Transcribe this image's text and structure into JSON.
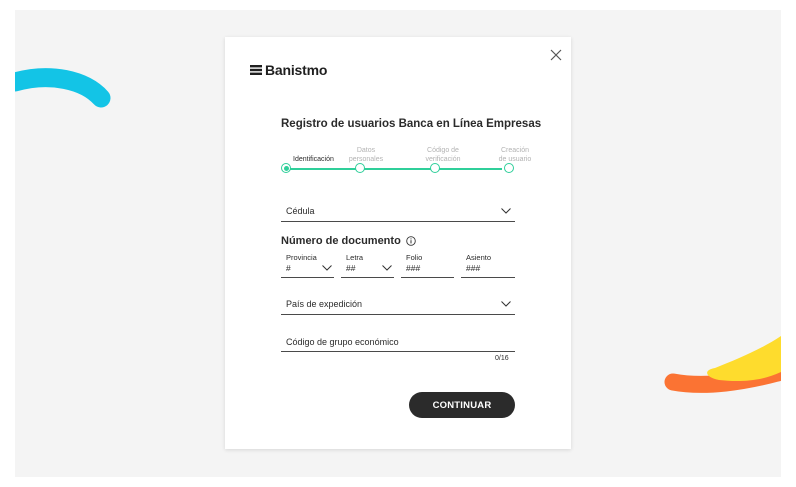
{
  "brand": {
    "name": "Banistmo",
    "logo_icon": "banistmo-logo-icon"
  },
  "colors": {
    "accent_green": "#2fcf9a",
    "button_dark": "#2b2b2b",
    "deco_cyan": "#13c4e6",
    "deco_yellow": "#fedc2d",
    "deco_orange": "#fb7333"
  },
  "modal": {
    "close_icon": "close-icon",
    "title": "Registro de usuarios Banca en Línea Empresas"
  },
  "stepper": {
    "steps": [
      {
        "label": "Identificación",
        "active": true
      },
      {
        "label_line1": "Datos",
        "label_line2": "personales",
        "active": false
      },
      {
        "label_line1": "Código de",
        "label_line2": "verificación",
        "active": false
      },
      {
        "label_line1": "Creación",
        "label_line2": "de usuario",
        "active": false
      }
    ]
  },
  "form": {
    "document_type": {
      "value": "Cédula",
      "icon": "chevron-down-icon"
    },
    "document_number": {
      "title": "Número de documento",
      "info_icon": "info-icon",
      "provincia": {
        "label": "Provincia",
        "placeholder": "#"
      },
      "letra": {
        "label": "Letra",
        "placeholder": "##"
      },
      "folio": {
        "label": "Folio",
        "placeholder": "###"
      },
      "asiento": {
        "label": "Asiento",
        "placeholder": "###"
      }
    },
    "pais": {
      "value": "País de expedición",
      "icon": "chevron-down-icon"
    },
    "grupo": {
      "placeholder": "Código de grupo económico",
      "counter": "0/16"
    },
    "submit_label": "CONTINUAR"
  }
}
